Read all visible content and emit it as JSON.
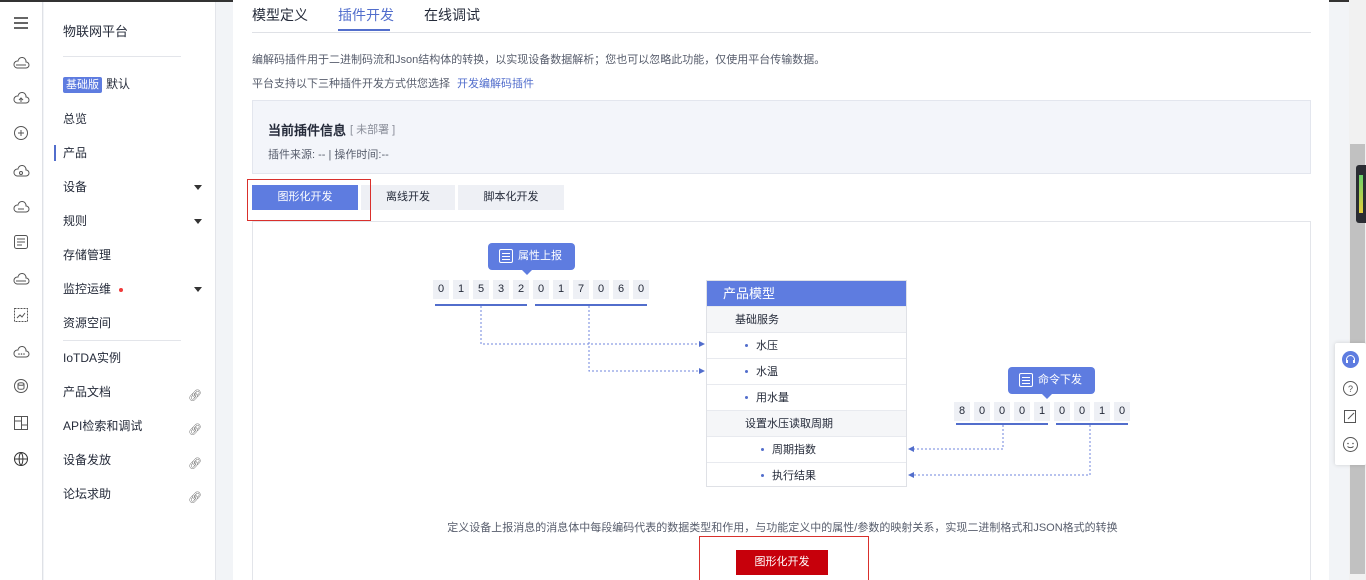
{
  "rail": {
    "icons": [
      "menu-icon",
      "cloud-icon",
      "cloud-upload-icon",
      "chat-icon",
      "cloud-sync-icon",
      "cloud-more-icon",
      "list-icon",
      "cloud-lock-icon",
      "chart-icon",
      "cloud-dots-icon",
      "database-icon",
      "layout-icon",
      "globe-icon"
    ]
  },
  "sidebar": {
    "title": "物联网平台",
    "edition_badge": "基础版",
    "edition_name": "默认",
    "items": [
      {
        "label": "总览"
      },
      {
        "label": "产品"
      },
      {
        "label": "设备"
      },
      {
        "label": "规则"
      },
      {
        "label": "存储管理"
      },
      {
        "label": "监控运维"
      },
      {
        "label": "资源空间"
      },
      {
        "label": "IoTDA实例"
      },
      {
        "label": "产品文档"
      },
      {
        "label": "API检索和调试"
      },
      {
        "label": "设备发放"
      },
      {
        "label": "论坛求助"
      }
    ]
  },
  "tabs": [
    {
      "label": "模型定义"
    },
    {
      "label": "插件开发"
    },
    {
      "label": "在线调试"
    }
  ],
  "description": {
    "line1": "编解码插件用于二进制码流和Json结构体的转换，以实现设备数据解析；您也可以忽略此功能，仅使用平台传输数据。",
    "line2": "平台支持以下三种插件开发方式供您选择",
    "link": "开发编解码插件"
  },
  "plugin_info": {
    "title": "当前插件信息",
    "status": "[ 未部署 ]",
    "meta": "插件来源: --  |  操作时间:--"
  },
  "dev_modes": [
    {
      "label": "图形化开发"
    },
    {
      "label": "离线开发"
    },
    {
      "label": "脚本化开发"
    }
  ],
  "diagram": {
    "report_pill": "属性上报",
    "report_digits": [
      "0",
      "1",
      "5",
      "3",
      "2",
      "0",
      "1",
      "7",
      "0",
      "6",
      "0"
    ],
    "command_pill": "命令下发",
    "command_digits": [
      "8",
      "0",
      "0",
      "0",
      "1",
      "0",
      "0",
      "1",
      "0"
    ],
    "model": {
      "title": "产品模型",
      "service1": "基础服务",
      "props": [
        "水压",
        "水温",
        "用水量"
      ],
      "service2": "设置水压读取周期",
      "params": [
        "周期指数",
        "执行结果"
      ]
    },
    "caption": "定义设备上报消息的消息体中每段编码代表的数据类型和作用，与功能定义中的属性/参数的映射关系，实现二进制格式和JSON格式的转换"
  },
  "cta_label": "图形化开发",
  "colors": {
    "accent": "#526ecc",
    "button_fill": "#5e7ce0",
    "cta": "#c7000b",
    "highlight_border": "#d9302c"
  },
  "float_icons": [
    "headset-icon",
    "help-icon",
    "edit-icon",
    "feedback-icon"
  ]
}
